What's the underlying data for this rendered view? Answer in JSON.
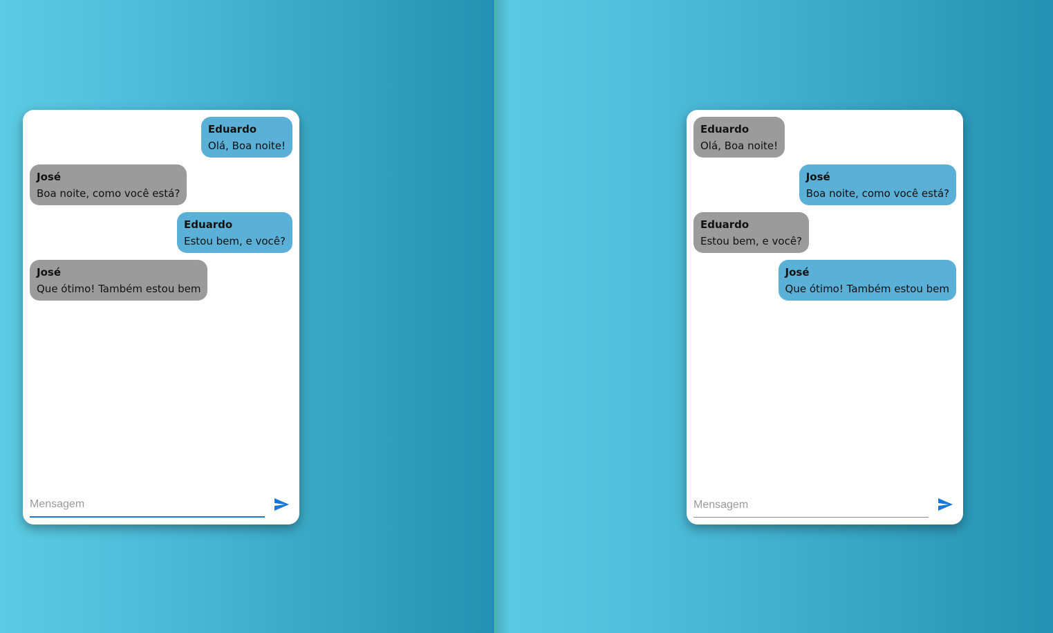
{
  "accent_color": "#1976d2",
  "sent_bubble_color": "#5ab0d6",
  "received_bubble_color": "#9b9b9b",
  "left_chat": {
    "messages": [
      {
        "author": "Eduardo",
        "text": "Olá, Boa noite!",
        "side": "sent"
      },
      {
        "author": "José",
        "text": "Boa noite, como você está?",
        "side": "received"
      },
      {
        "author": "Eduardo",
        "text": "Estou bem, e você?",
        "side": "sent"
      },
      {
        "author": "José",
        "text": "Que ótimo! Também estou bem",
        "side": "received"
      }
    ],
    "input": {
      "placeholder": "Mensagem",
      "value": "",
      "focused": true
    },
    "send_icon": "send-icon"
  },
  "right_chat": {
    "messages": [
      {
        "author": "Eduardo",
        "text": "Olá, Boa noite!",
        "side": "received"
      },
      {
        "author": "José",
        "text": "Boa noite, como você está?",
        "side": "sent"
      },
      {
        "author": "Eduardo",
        "text": "Estou bem, e você?",
        "side": "received"
      },
      {
        "author": "José",
        "text": "Que ótimo! Também estou bem",
        "side": "sent"
      }
    ],
    "input": {
      "placeholder": "Mensagem",
      "value": "",
      "focused": false
    },
    "send_icon": "send-icon"
  }
}
